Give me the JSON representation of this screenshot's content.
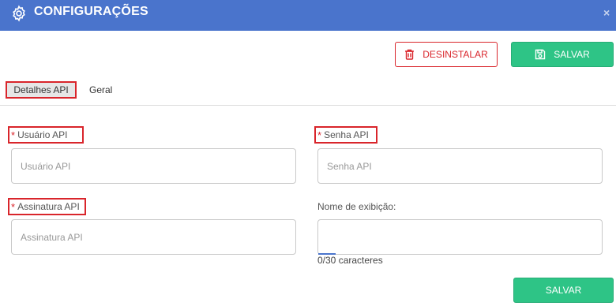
{
  "header": {
    "title": "CONFIGURAÇÕES",
    "close_label": "×",
    "background_color": "#4a74cc"
  },
  "toolbar": {
    "uninstall_label": "DESINSTALAR",
    "save_label": "SALVAR"
  },
  "tabs": [
    {
      "label": "Detalhes API",
      "active": true
    },
    {
      "label": "Geral",
      "active": false
    }
  ],
  "form": {
    "user": {
      "label": "Usuário API",
      "placeholder": "Usuário API",
      "required": true
    },
    "password": {
      "label": "Senha API",
      "placeholder": "Senha API",
      "required": true
    },
    "signature": {
      "label": "Assinatura API",
      "placeholder": "Assinatura API",
      "required": true
    },
    "display_name": {
      "label": "Nome de exibição:",
      "placeholder": "",
      "required": false,
      "counter": "0/30 caracteres"
    },
    "required_marker": "*"
  },
  "footer": {
    "save_label": "SALVAR"
  },
  "colors": {
    "accent_green": "#2ec486",
    "danger_red": "#d9252b"
  },
  "icons": {
    "header": "gear-icon",
    "uninstall": "trash-icon",
    "save": "floppy-disk-icon"
  }
}
